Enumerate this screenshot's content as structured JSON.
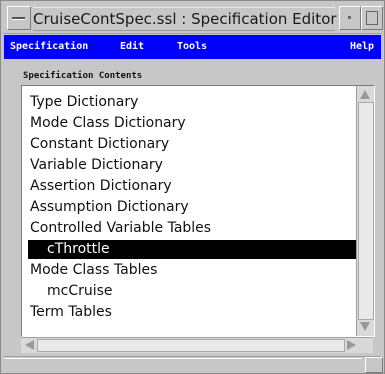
{
  "window": {
    "title": "CruiseContSpec.ssl : Specification Editor"
  },
  "menubar": {
    "background": "#0000ff",
    "items": [
      {
        "label": "Specification"
      },
      {
        "label": "Edit"
      },
      {
        "label": "Tools"
      },
      {
        "label": "Help"
      }
    ]
  },
  "contents": {
    "label": "Specification Contents",
    "items": [
      {
        "label": "Type Dictionary",
        "indent": false,
        "selected": false
      },
      {
        "label": "Mode Class Dictionary",
        "indent": false,
        "selected": false
      },
      {
        "label": "Constant Dictionary",
        "indent": false,
        "selected": false
      },
      {
        "label": "Variable Dictionary",
        "indent": false,
        "selected": false
      },
      {
        "label": "Assertion Dictionary",
        "indent": false,
        "selected": false
      },
      {
        "label": "Assumption Dictionary",
        "indent": false,
        "selected": false
      },
      {
        "label": "Controlled Variable Tables",
        "indent": false,
        "selected": false
      },
      {
        "label": "cThrottle",
        "indent": true,
        "selected": true
      },
      {
        "label": "Mode Class Tables",
        "indent": false,
        "selected": false
      },
      {
        "label": "mcCruise",
        "indent": true,
        "selected": false
      },
      {
        "label": "Term Tables",
        "indent": false,
        "selected": false
      }
    ]
  }
}
